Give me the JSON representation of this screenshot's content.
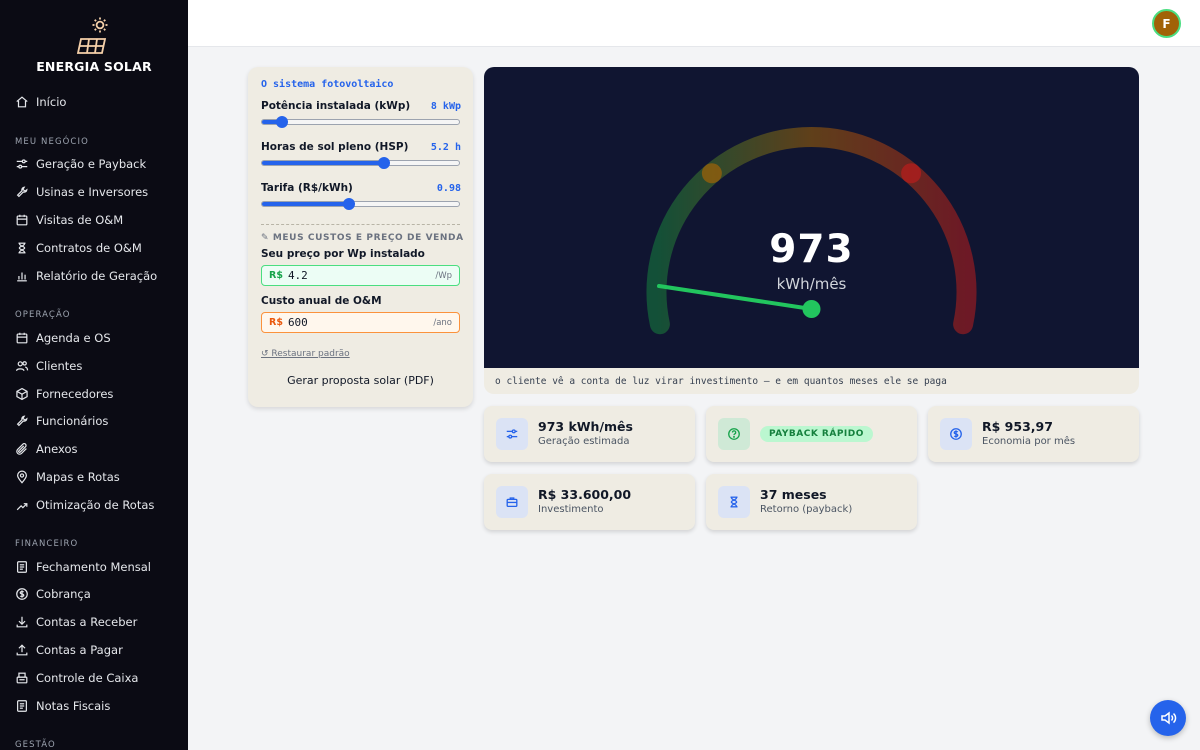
{
  "brand": {
    "name": "ENERGIA SOLAR"
  },
  "sidebar": {
    "home": {
      "label": "Início",
      "icon": "home-icon"
    },
    "sections": [
      {
        "title": "MEU NEGÓCIO",
        "items": [
          {
            "label": "Geração e Payback",
            "icon": "sliders-icon"
          },
          {
            "label": "Usinas e Inversores",
            "icon": "wrench-icon"
          },
          {
            "label": "Visitas de O&M",
            "icon": "calendar-icon"
          },
          {
            "label": "Contratos de O&M",
            "icon": "hourglass-icon"
          },
          {
            "label": "Relatório de Geração",
            "icon": "bar-chart-icon"
          }
        ]
      },
      {
        "title": "OPERAÇÃO",
        "items": [
          {
            "label": "Agenda e OS",
            "icon": "calendar-icon"
          },
          {
            "label": "Clientes",
            "icon": "users-icon"
          },
          {
            "label": "Fornecedores",
            "icon": "box-icon"
          },
          {
            "label": "Funcionários",
            "icon": "wrench-icon"
          },
          {
            "label": "Anexos",
            "icon": "paperclip-icon"
          },
          {
            "label": "Mapas e Rotas",
            "icon": "map-pin-icon"
          },
          {
            "label": "Otimização de Rotas",
            "icon": "route-icon"
          }
        ]
      },
      {
        "title": "FINANCEIRO",
        "items": [
          {
            "label": "Fechamento Mensal",
            "icon": "document-icon"
          },
          {
            "label": "Cobrança",
            "icon": "dollar-circle-icon"
          },
          {
            "label": "Contas a Receber",
            "icon": "download-icon"
          },
          {
            "label": "Contas a Pagar",
            "icon": "upload-icon"
          },
          {
            "label": "Controle de Caixa",
            "icon": "cash-register-icon"
          },
          {
            "label": "Notas Fiscais",
            "icon": "document-icon"
          }
        ]
      },
      {
        "title": "GESTÃO",
        "items": []
      }
    ]
  },
  "topbar": {
    "avatar_initial": "F"
  },
  "controls": {
    "title": "O sistema fotovoltaico",
    "sliders": [
      {
        "label": "Potência instalada (kWp)",
        "value": "8 kWp",
        "fraction": 0.1
      },
      {
        "label": "Horas de sol pleno (HSP)",
        "value": "5.2 h",
        "fraction": 0.62
      },
      {
        "label": "Tarifa (R$/kWh)",
        "value": "0.98",
        "fraction": 0.44
      }
    ],
    "costs_title": "✎ MEUS CUSTOS E PREÇO DE VENDA",
    "price_label": "Seu preço por Wp instalado",
    "price_prefix": "R$",
    "price_value": "4.2",
    "price_suffix": "/Wp",
    "om_label": "Custo anual de O&M",
    "om_prefix": "R$",
    "om_value": "600",
    "om_suffix": "/ano",
    "restore_label": "↺ Restaurar padrão",
    "pdf_label": "Gerar proposta solar (PDF)"
  },
  "gauge": {
    "value": "973",
    "unit": "kWh/mês",
    "fraction": 0.04,
    "caption": "o cliente vê a conta de luz virar investimento — e em quantos meses ele se paga",
    "colors": {
      "low": "#15803d",
      "mid": "#a16207",
      "high": "#b91c1c",
      "needle": "#22c55e"
    }
  },
  "stats": [
    {
      "title": "973 kWh/mês",
      "subtitle": "Geração estimada",
      "icon": "sliders-icon"
    },
    {
      "badge": "PAYBACK RÁPIDO",
      "icon": "question-circle-icon"
    },
    {
      "title": "R$ 953,97",
      "subtitle": "Economia por mês",
      "icon": "dollar-circle-icon"
    },
    {
      "title": "R$ 33.600,00",
      "subtitle": "Investimento",
      "icon": "briefcase-icon"
    },
    {
      "title": "37 meses",
      "subtitle": "Retorno (payback)",
      "icon": "hourglass-icon"
    }
  ],
  "fab": {
    "icon": "speaker-icon"
  }
}
